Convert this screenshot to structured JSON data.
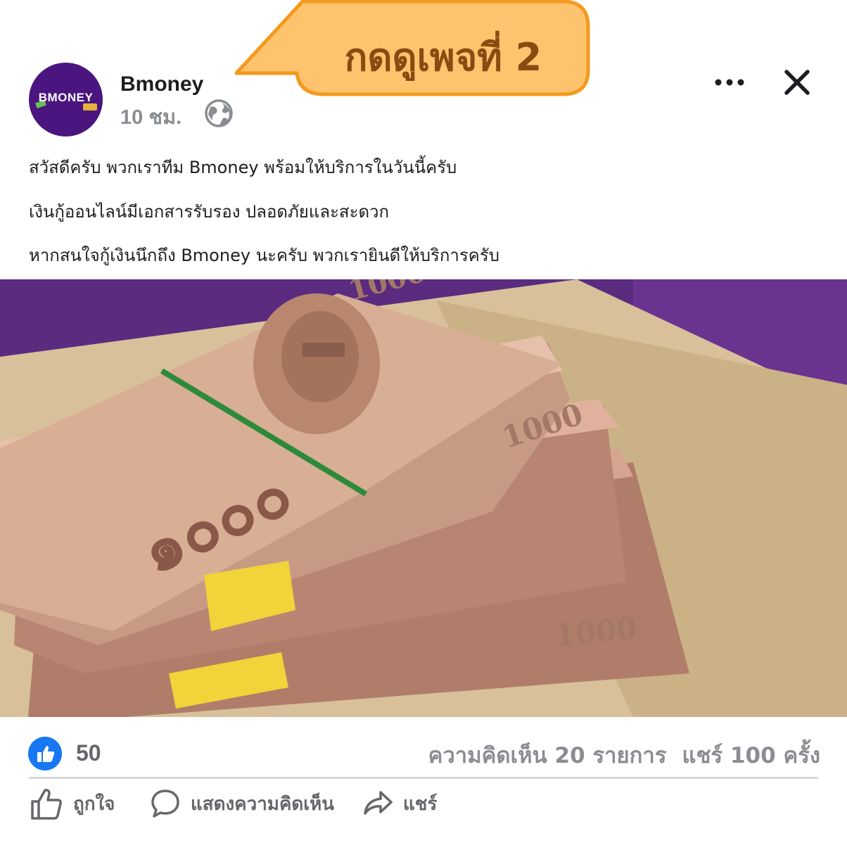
{
  "callout": {
    "text": "กดดูเพจที่ 2"
  },
  "post": {
    "avatar_text": "BMONEY",
    "page_name": "Bmoney",
    "time": "10 ชม.",
    "lines": [
      "สวัสดีครับ พวกเราทีม Bmoney พร้อมให้บริการในวันนี้ครับ",
      "เงินกู้ออนไลน์มีเอกสารรับรอง ปลอดภัยและสะดวก",
      "หากสนใจกู้เงินนึกถึง Bmoney นะครับ พวกเรายินดีให้บริการครับ"
    ]
  },
  "reactions": {
    "like_count": "50",
    "comments": "ความคิดเห็น 20 รายการ",
    "shares": "แชร์ 100 ครั้ง"
  },
  "actions": {
    "like": "ถูกใจ",
    "comment": "แสดงความคิดเห็น",
    "share": "แชร์"
  },
  "colors": {
    "accent": "#1877f2",
    "callout_fill": "#fdc36d",
    "callout_border": "#f39a1c",
    "callout_text": "#8b4a12",
    "avatar_bg": "#4b1580"
  },
  "icons": [
    "globe-icon",
    "more-icon",
    "close-icon",
    "like-icon",
    "comment-icon",
    "share-icon",
    "thumbs-up-icon"
  ]
}
